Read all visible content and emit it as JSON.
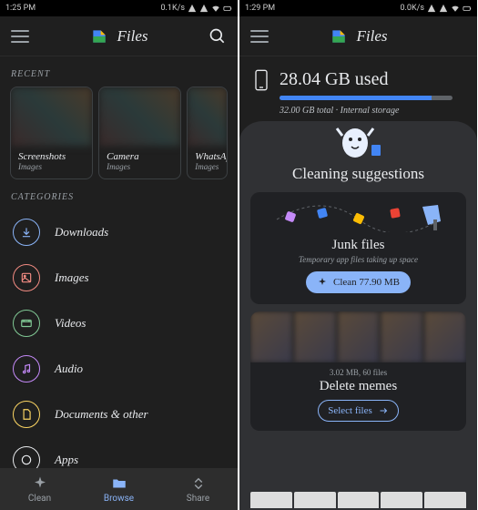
{
  "left": {
    "status": {
      "time": "1:25 PM",
      "net": "0.1K/s"
    },
    "appbar": {
      "title": "Files"
    },
    "recent": {
      "label": "RECENT",
      "cards": [
        {
          "title": "Screenshots",
          "sub": "Images"
        },
        {
          "title": "Camera",
          "sub": "Images"
        },
        {
          "title": "WhatsAp",
          "sub": "Images"
        }
      ]
    },
    "categories": {
      "label": "CATEGORIES",
      "items": [
        {
          "label": "Downloads",
          "color": "#8ab4f8"
        },
        {
          "label": "Images",
          "color": "#f28b82"
        },
        {
          "label": "Videos",
          "color": "#81c995"
        },
        {
          "label": "Audio",
          "color": "#c58af9"
        },
        {
          "label": "Documents & other",
          "color": "#fdd663"
        },
        {
          "label": "Apps",
          "color": "#e8eaed"
        }
      ]
    },
    "bnav": {
      "items": [
        {
          "label": "Clean"
        },
        {
          "label": "Browse"
        },
        {
          "label": "Share"
        }
      ]
    }
  },
  "right": {
    "status": {
      "time": "1:29 PM",
      "net": "0.0K/s"
    },
    "appbar": {
      "title": "Files"
    },
    "storage": {
      "used": "28.04 GB used",
      "sub": "32.00 GB total · Internal storage",
      "pct": 88
    },
    "cleaning": {
      "title": "Cleaning suggestions",
      "junk": {
        "title": "Junk files",
        "sub": "Temporary app files taking up space",
        "button": "Clean 77.90 MB"
      },
      "memes": {
        "meta": "3.02 MB, 60 files",
        "title": "Delete memes",
        "button": "Select files"
      }
    }
  }
}
